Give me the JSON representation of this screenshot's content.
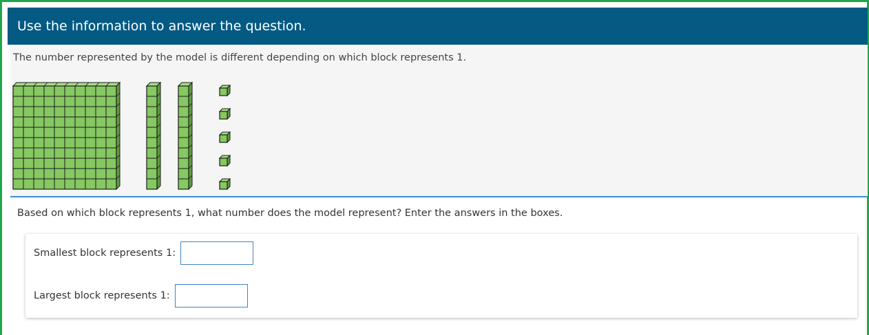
{
  "header": {
    "title": "Use the information to answer the question."
  },
  "stimulus": {
    "text": "The number represented by the model is different depending on which block represents 1.",
    "model": {
      "flats": 1,
      "rods": 2,
      "units": 5,
      "block_color": "#86c861"
    }
  },
  "question": {
    "prompt": "Based on which block represents 1, what number does the model represent? Enter the answers in the boxes.",
    "answers": [
      {
        "label": "Smallest block represents 1:",
        "value": ""
      },
      {
        "label": "Largest block represents 1:",
        "value": ""
      }
    ]
  },
  "colors": {
    "frame_border": "#21a64a",
    "header_bg": "#045a83",
    "stimulus_bg": "#f5f5f5",
    "divider": "#3a8fd0",
    "input_border": "#3f83c8"
  }
}
